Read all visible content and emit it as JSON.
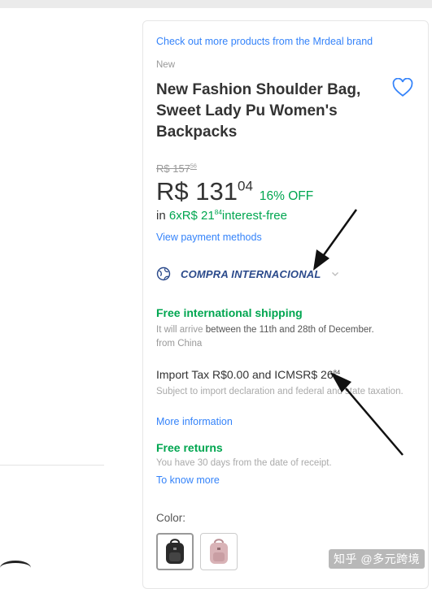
{
  "product": {
    "brand_link": "Check out more products from the Mrdeal brand",
    "condition": "New",
    "title": "New Fashion Shoulder Bag, Sweet Lady Pu Women's Backpacks",
    "old_price": "R$ 157",
    "old_price_cents": "56",
    "price": "R$ 131",
    "price_cents": "04",
    "discount": "16% OFF",
    "installments_prefix": "in",
    "installments_value": "6xR$ 21",
    "installments_cents": "84",
    "installments_suffix": "interest-free",
    "payment_methods_link": "View payment methods"
  },
  "international": {
    "label": "COMPRA INTERNACIONAL",
    "icon": "globe-icon"
  },
  "shipping": {
    "title": "Free international shipping",
    "detail_prefix": "It will arrive",
    "detail_range": "between the 11th and 28th of December.",
    "detail_origin": "from China"
  },
  "tax": {
    "label": "Import Tax R$0.00 and ICMSR$ 26",
    "cents": "84",
    "subtitle": "Subject to import declaration and federal and state taxation.",
    "more_link": "More information"
  },
  "returns": {
    "title": "Free returns",
    "subtitle": "You have 30 days from the date of receipt.",
    "link": "To know more"
  },
  "color": {
    "label": "Color:",
    "options": [
      "black",
      "pink"
    ]
  },
  "watermark": "知乎 @多元跨境",
  "colors": {
    "link_blue": "#3483fa",
    "green": "#00a650",
    "intl_blue": "#2b4a8b"
  }
}
